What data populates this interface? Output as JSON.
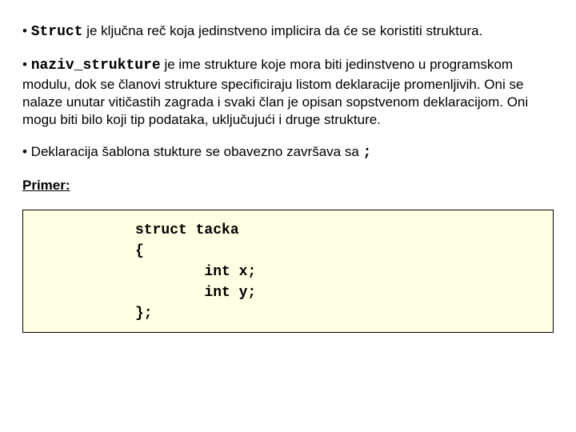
{
  "p1": {
    "bullet": "• ",
    "kw": "Struct",
    "rest": " je ključna reč koja jedinstveno implicira da će se koristiti struktura."
  },
  "p2": {
    "bullet": "• ",
    "kw": "naziv_strukture",
    "rest": " je ime strukture koje mora biti jedinstveno u programskom modulu, dok se članovi strukture specificiraju listom deklaracije promenljivih. Oni se nalaze unutar vitičastih zagrada i svaki član je opisan sopstvenom deklaracijom. Oni mogu biti bilo koji tip podataka, uključujući i druge strukture."
  },
  "p3": {
    "bullet": "• Deklaracija šablona stukture se obavezno završava sa ",
    "semicolon": ";"
  },
  "primer_label": "Primer:",
  "code": "struct tacka\n{\n        int x;\n        int y;\n};"
}
